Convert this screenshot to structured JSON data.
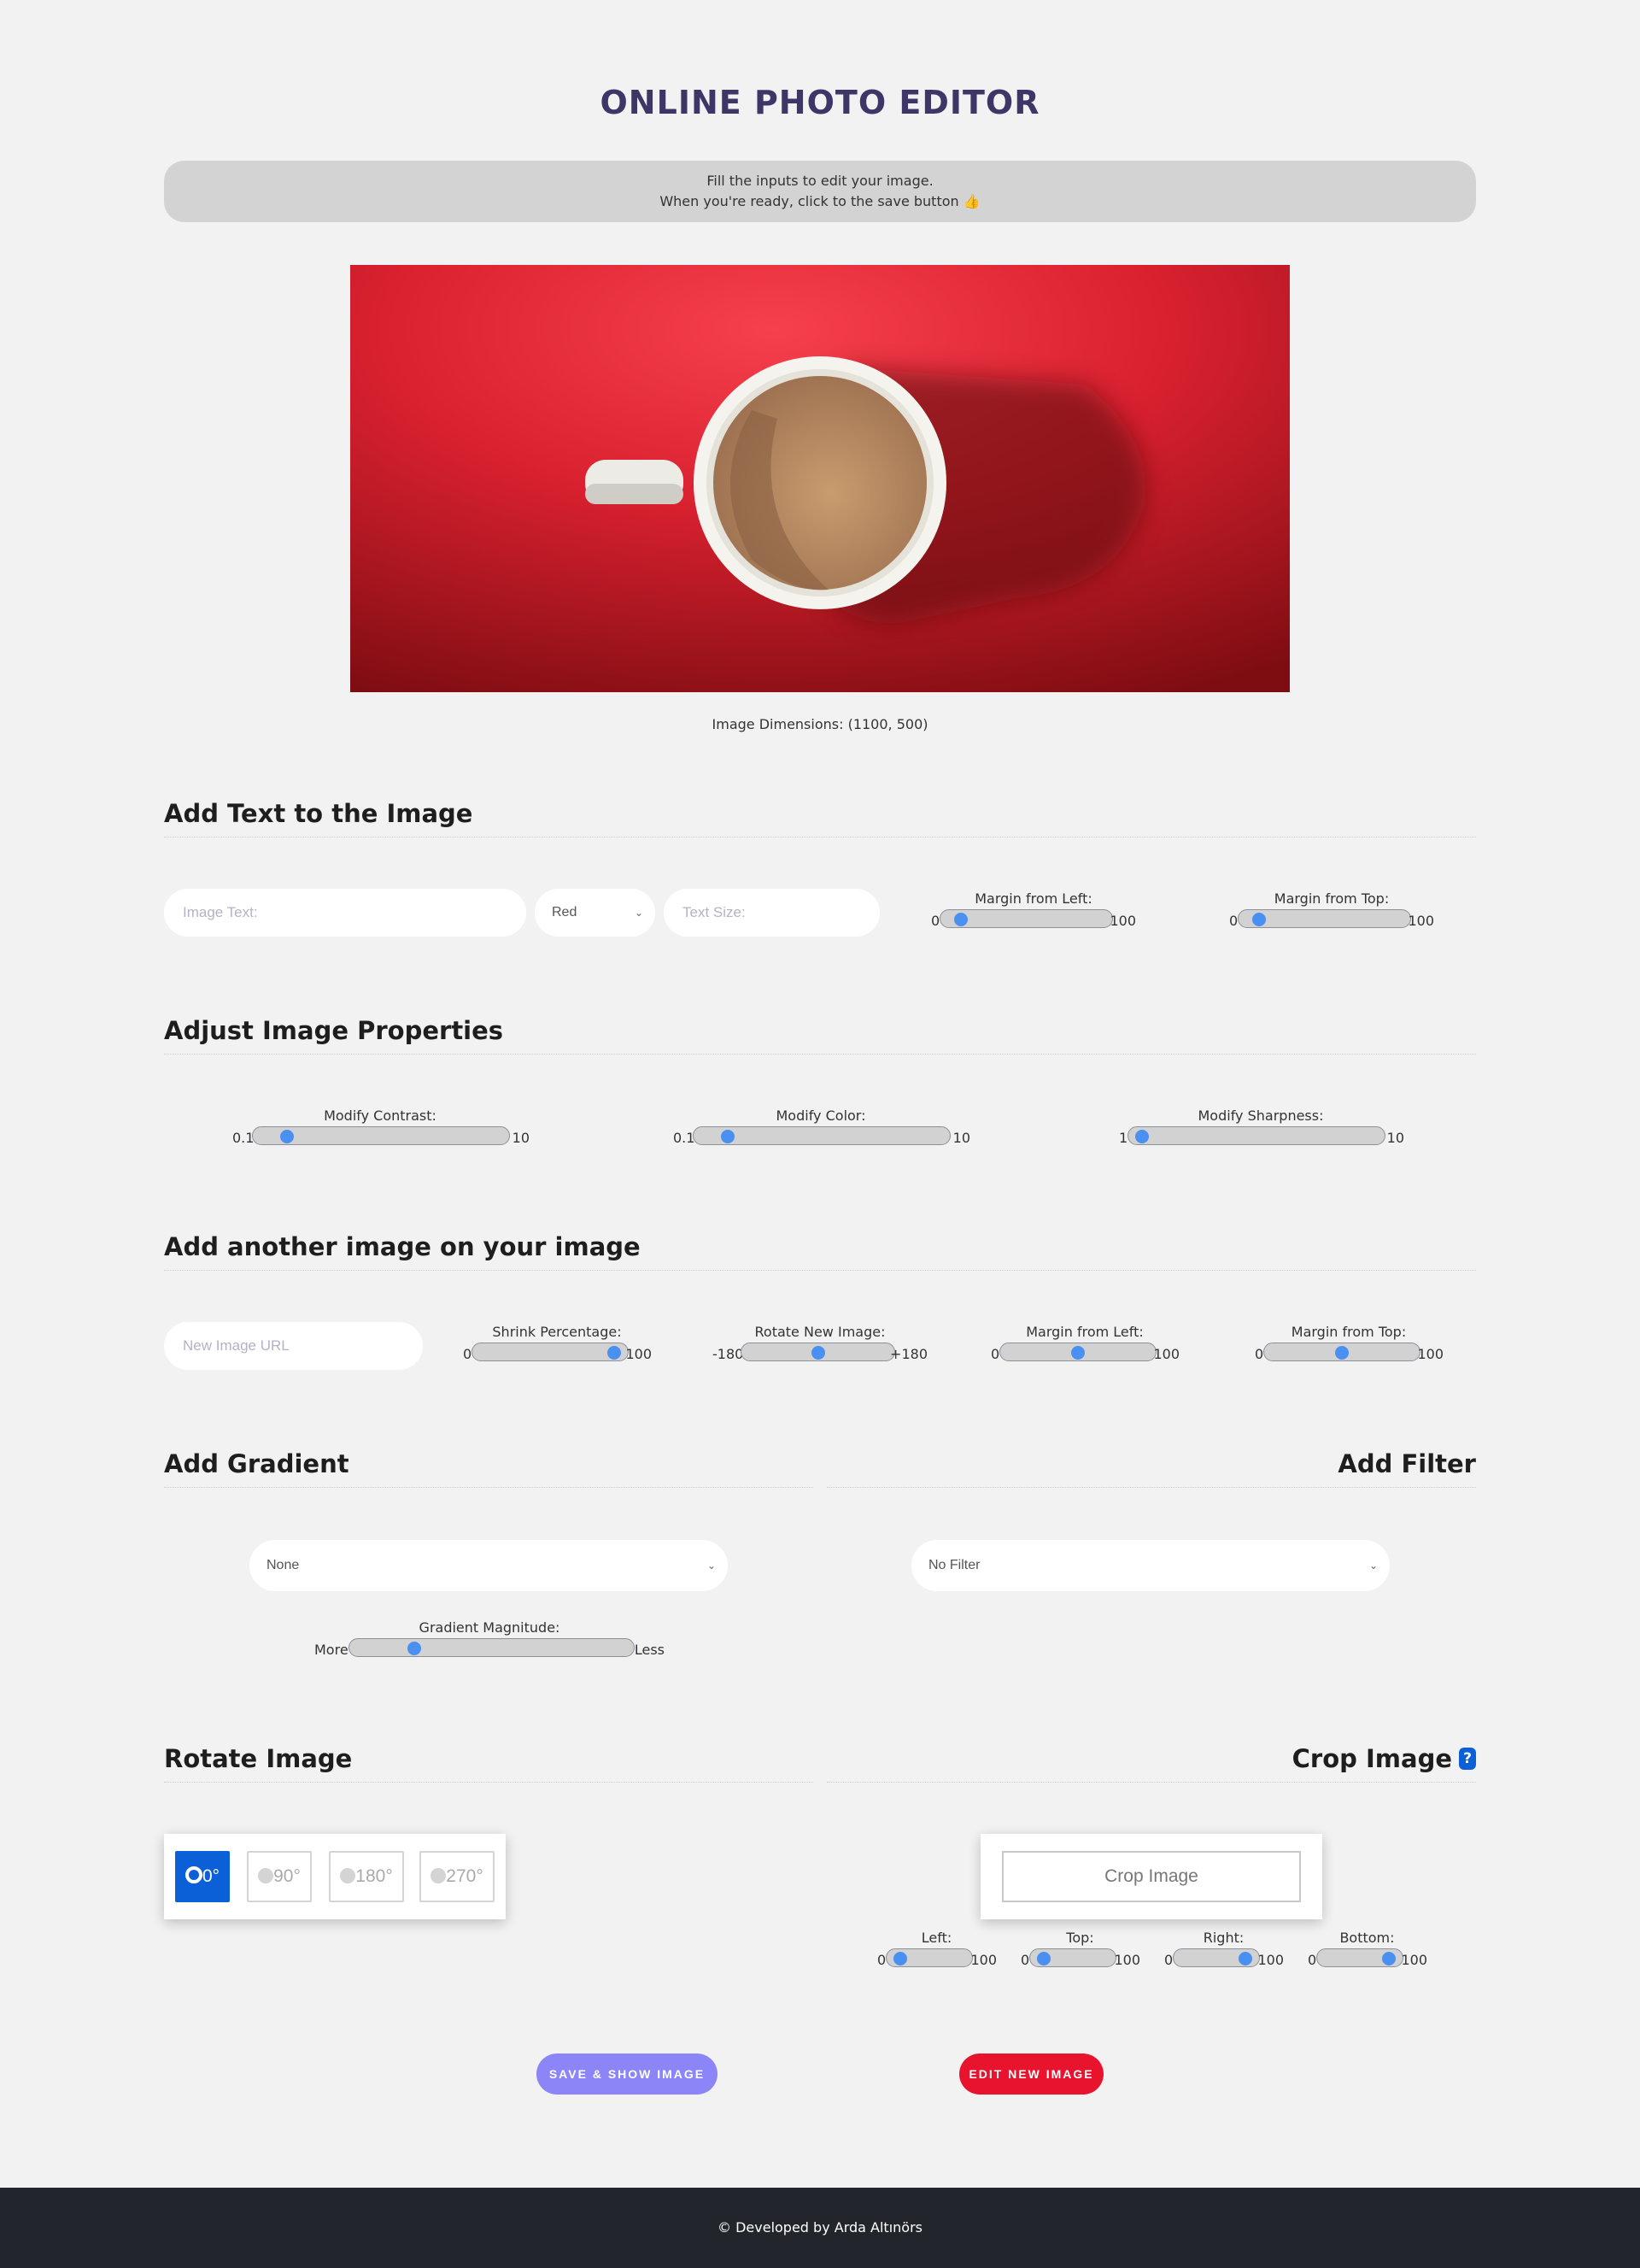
{
  "page": {
    "title": "ONLINE PHOTO EDITOR",
    "info_line1": "Fill the inputs to edit your image.",
    "info_line2": "When you're ready, click to the save button 👍",
    "dimensions": "Image Dimensions: (1100, 500)"
  },
  "add_text": {
    "heading": "Add Text to the Image",
    "text_placeholder": "Image Text:",
    "color_selected": "Red",
    "size_placeholder": "Text Size:",
    "margin_left": {
      "label": "Margin from Left:",
      "min": "0",
      "max": "100",
      "value": 5
    },
    "margin_top": {
      "label": "Margin from Top:",
      "min": "0",
      "max": "100",
      "value": 5
    }
  },
  "properties": {
    "heading": "Adjust Image Properties",
    "contrast": {
      "label": "Modify Contrast:",
      "min": "0.1",
      "max": "10",
      "value": 1
    },
    "color": {
      "label": "Modify Color:",
      "min": "0.1",
      "max": "10",
      "value": 1
    },
    "sharpness": {
      "label": "Modify Sharpness:",
      "min": "1",
      "max": "10",
      "value": 1
    }
  },
  "overlay": {
    "heading": "Add another image on your image",
    "url_placeholder": "New Image URL",
    "shrink": {
      "label": "Shrink Percentage:",
      "min": "0",
      "max": "100",
      "value": 100
    },
    "rotate": {
      "label": "Rotate New Image:",
      "min": "-180",
      "max": "+180",
      "value": 0
    },
    "margin_left": {
      "label": "Margin from Left:",
      "min": "0",
      "max": "100",
      "value": 50
    },
    "margin_top": {
      "label": "Margin from Top:",
      "min": "0",
      "max": "100",
      "value": 50
    }
  },
  "gradient": {
    "heading": "Add Gradient",
    "selected": "None",
    "magnitude": {
      "label": "Gradient Magnitude:",
      "min": "More",
      "max": "Less",
      "value": 20
    }
  },
  "filter": {
    "heading": "Add Filter",
    "selected": "No Filter"
  },
  "rotate": {
    "heading": "Rotate Image",
    "options": [
      "0°",
      "90°",
      "180°",
      "270°"
    ],
    "selected_index": 0
  },
  "crop": {
    "heading": "Crop Image",
    "help_icon": "?",
    "button": "Crop Image",
    "left": {
      "label": "Left:",
      "min": "0",
      "max": "100",
      "value": 0
    },
    "top": {
      "label": "Top:",
      "min": "0",
      "max": "100",
      "value": 0
    },
    "right": {
      "label": "Right:",
      "min": "0",
      "max": "100",
      "value": 100
    },
    "bottom": {
      "label": "Bottom:",
      "min": "0",
      "max": "100",
      "value": 100
    }
  },
  "actions": {
    "save": "SAVE & SHOW IMAGE",
    "edit_new": "EDIT NEW IMAGE",
    "save_color": "#8c85f7",
    "edit_color": "#e8132d"
  },
  "footer": {
    "text": "© Developed by Arda Altınörs"
  },
  "colors": {
    "title": "#3d3667",
    "accent_blue": "#0b5fd7",
    "slider_thumb": "#4a90f0"
  }
}
